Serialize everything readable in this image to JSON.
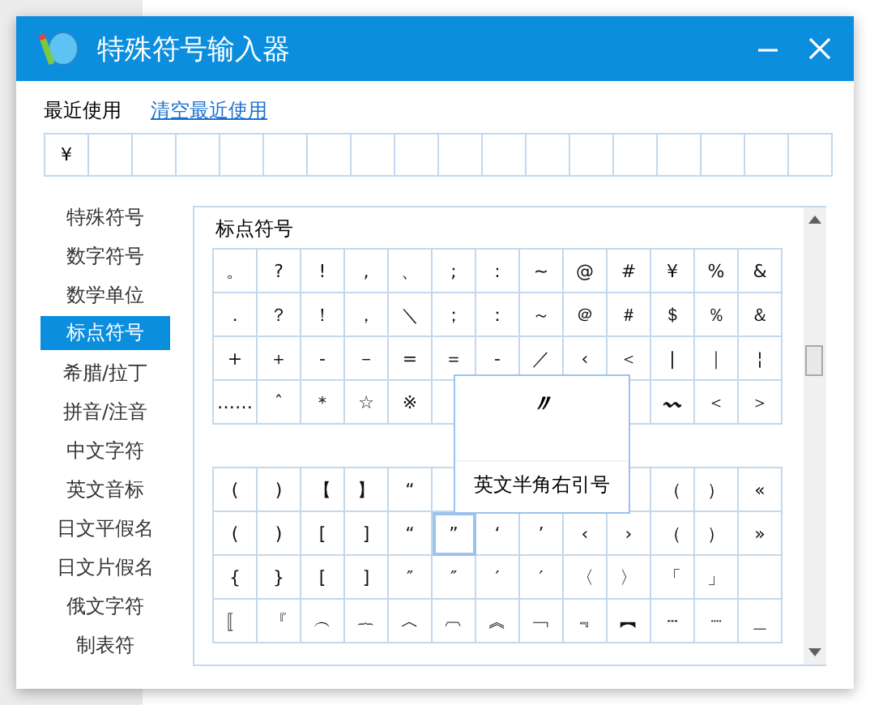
{
  "window": {
    "title": "特殊符号输入器"
  },
  "recent": {
    "label": "最近使用",
    "clear_link": "清空最近使用",
    "cells": [
      "¥"
    ]
  },
  "categories": [
    {
      "label": "特殊符号",
      "selected": false
    },
    {
      "label": "数字符号",
      "selected": false
    },
    {
      "label": "数学单位",
      "selected": false
    },
    {
      "label": "标点符号",
      "selected": true
    },
    {
      "label": "希腊/拉丁",
      "selected": false
    },
    {
      "label": "拼音/注音",
      "selected": false
    },
    {
      "label": "中文字符",
      "selected": false
    },
    {
      "label": "英文音标",
      "selected": false
    },
    {
      "label": "日文平假名",
      "selected": false
    },
    {
      "label": "日文片假名",
      "selected": false
    },
    {
      "label": "俄文字符",
      "selected": false
    },
    {
      "label": "制表符",
      "selected": false
    }
  ],
  "panel": {
    "title": "标点符号",
    "grids": [
      {
        "rows": [
          [
            {
              "symbol": "。",
              "selected": false
            },
            {
              "symbol": "?",
              "selected": false
            },
            {
              "symbol": "!",
              "selected": false
            },
            {
              "symbol": ",",
              "selected": false
            },
            {
              "symbol": "、",
              "selected": false
            },
            {
              "symbol": ";",
              "selected": false
            },
            {
              "symbol": ":",
              "selected": false
            },
            {
              "symbol": "~",
              "selected": false
            },
            {
              "symbol": "@",
              "selected": false
            },
            {
              "symbol": "#",
              "selected": false
            },
            {
              "symbol": "¥",
              "selected": false
            },
            {
              "symbol": "%",
              "selected": false
            },
            {
              "symbol": "&",
              "selected": false
            }
          ],
          [
            {
              "symbol": "．",
              "selected": false
            },
            {
              "symbol": "？",
              "selected": false
            },
            {
              "symbol": "！",
              "selected": false
            },
            {
              "symbol": "，",
              "selected": false
            },
            {
              "symbol": "＼",
              "selected": false
            },
            {
              "symbol": "；",
              "selected": false
            },
            {
              "symbol": "：",
              "selected": false
            },
            {
              "symbol": "～",
              "selected": false
            },
            {
              "symbol": "＠",
              "selected": false
            },
            {
              "symbol": "＃",
              "selected": false
            },
            {
              "symbol": "＄",
              "selected": false
            },
            {
              "symbol": "％",
              "selected": false
            },
            {
              "symbol": "＆",
              "selected": false
            }
          ],
          [
            {
              "symbol": "+",
              "selected": false
            },
            {
              "symbol": "＋",
              "selected": false
            },
            {
              "symbol": "-",
              "selected": false
            },
            {
              "symbol": "－",
              "selected": false
            },
            {
              "symbol": "=",
              "selected": false
            },
            {
              "symbol": "＝",
              "selected": false
            },
            {
              "symbol": "‐",
              "selected": false
            },
            {
              "symbol": "／",
              "selected": false
            },
            {
              "symbol": "‹",
              "selected": false
            },
            {
              "symbol": "＜",
              "selected": false
            },
            {
              "symbol": "|",
              "selected": false
            },
            {
              "symbol": "｜",
              "selected": false
            },
            {
              "symbol": "¦",
              "selected": false
            }
          ],
          [
            {
              "symbol": "……",
              "selected": false
            },
            {
              "symbol": "ˆ",
              "selected": false
            },
            {
              "symbol": "＊",
              "selected": false
            },
            {
              "symbol": "☆",
              "selected": false
            },
            {
              "symbol": "※",
              "selected": false
            },
            {
              "kind": "empty"
            },
            null,
            null,
            null,
            {
              "kind": "empty"
            },
            {
              "symbol": "〰",
              "selected": false
            },
            {
              "symbol": "＜",
              "selected": false
            },
            {
              "symbol": "＞",
              "selected": false
            }
          ]
        ]
      },
      {
        "rows": [
          [
            {
              "symbol": "(",
              "selected": false
            },
            {
              "symbol": ")",
              "selected": false
            },
            {
              "symbol": "【",
              "selected": false
            },
            {
              "symbol": "】",
              "selected": false
            },
            {
              "symbol": "“",
              "selected": false
            },
            {
              "kind": "empty"
            },
            null,
            null,
            null,
            {
              "kind": "empty"
            },
            {
              "symbol": "（",
              "selected": false
            },
            {
              "symbol": "）",
              "selected": false
            },
            {
              "symbol": "«",
              "selected": false
            }
          ],
          [
            {
              "symbol": "(",
              "selected": false
            },
            {
              "symbol": ")",
              "selected": false
            },
            {
              "symbol": "[",
              "selected": false
            },
            {
              "symbol": "]",
              "selected": false
            },
            {
              "symbol": "“",
              "selected": false
            },
            {
              "symbol": "”",
              "selected": true
            },
            {
              "symbol": "‘",
              "selected": false
            },
            {
              "symbol": "’",
              "selected": false
            },
            {
              "symbol": "‹",
              "selected": false
            },
            {
              "symbol": "›",
              "selected": false
            },
            {
              "symbol": "（",
              "selected": false
            },
            {
              "symbol": "）",
              "selected": false
            },
            {
              "symbol": "»",
              "selected": false
            }
          ],
          [
            {
              "symbol": "{",
              "selected": false
            },
            {
              "symbol": "}",
              "selected": false
            },
            {
              "symbol": "[",
              "selected": false
            },
            {
              "symbol": "]",
              "selected": false
            },
            {
              "symbol": "″",
              "selected": false
            },
            {
              "symbol": "″",
              "selected": false
            },
            {
              "symbol": "′",
              "selected": false
            },
            {
              "symbol": "′",
              "selected": false
            },
            {
              "symbol": "〈",
              "selected": false
            },
            {
              "symbol": "〉",
              "selected": false
            },
            {
              "symbol": "「",
              "selected": false
            },
            {
              "symbol": "」",
              "selected": false
            },
            {
              "kind": "empty"
            }
          ],
          [
            {
              "symbol": "〚",
              "selected": false
            },
            {
              "symbol": "『",
              "selected": false
            },
            {
              "symbol": "︵",
              "selected": false
            },
            {
              "symbol": "︷",
              "selected": false
            },
            {
              "symbol": "︿",
              "selected": false
            },
            {
              "symbol": "︹",
              "selected": false
            },
            {
              "symbol": "︽",
              "selected": false
            },
            {
              "symbol": "﹁",
              "selected": false
            },
            {
              "symbol": "﹃",
              "selected": false
            },
            {
              "symbol": "︻",
              "selected": false
            },
            {
              "symbol": "┄",
              "selected": false
            },
            {
              "symbol": "┈",
              "selected": false
            },
            {
              "symbol": "＿",
              "selected": false
            }
          ]
        ]
      }
    ]
  },
  "tooltip": {
    "symbol": "〃",
    "label": "英文半角右引号"
  }
}
